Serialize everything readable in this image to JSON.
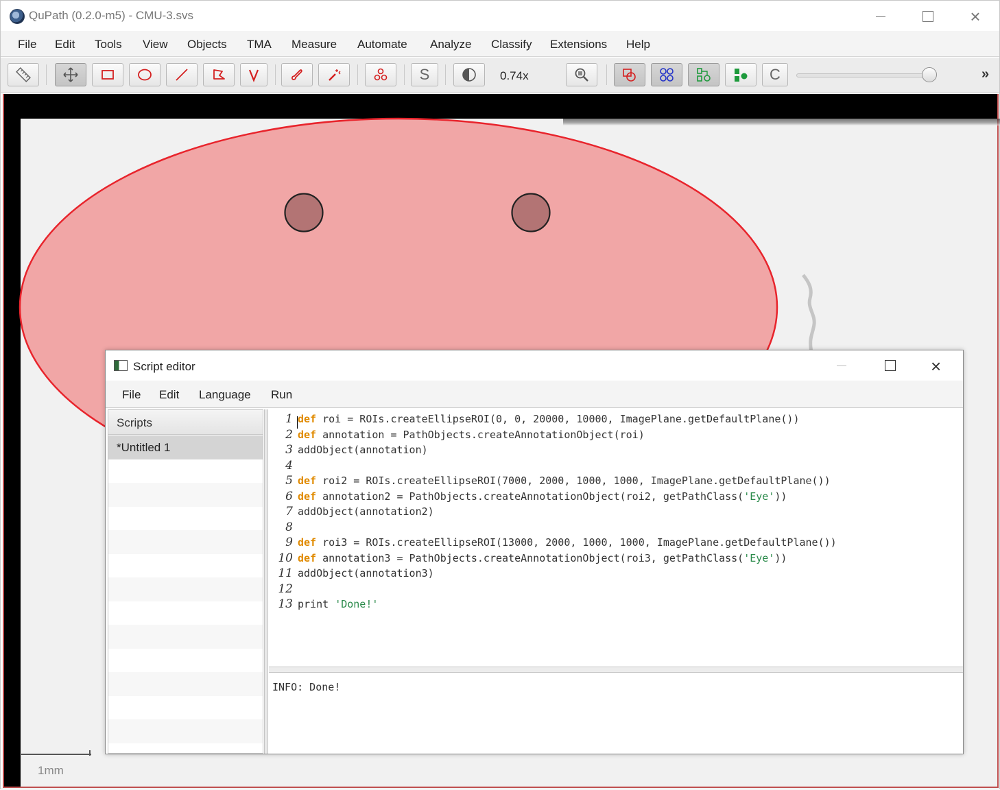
{
  "window": {
    "title": "QuPath (0.2.0-m5) - CMU-3.svs"
  },
  "menubar": {
    "items": [
      "File",
      "Edit",
      "Tools",
      "View",
      "Objects",
      "TMA",
      "Measure",
      "Automate",
      "Analyze",
      "Classify",
      "Extensions",
      "Help"
    ]
  },
  "toolbar": {
    "tools": [
      {
        "name": "measure-ruler-icon"
      },
      {
        "name": "move-icon",
        "active": true
      },
      {
        "name": "rectangle-icon"
      },
      {
        "name": "ellipse-icon"
      },
      {
        "name": "line-icon"
      },
      {
        "name": "polygon-icon"
      },
      {
        "name": "polyline-icon"
      },
      {
        "name": "brush-icon"
      },
      {
        "name": "wand-icon"
      },
      {
        "name": "points-icon"
      },
      {
        "name": "selection-mode-icon"
      },
      {
        "name": "brightness-contrast-icon"
      },
      {
        "name": "zoom-to-fit-icon"
      },
      {
        "name": "show-annotations-icon",
        "active": true
      },
      {
        "name": "show-tma-grid-icon",
        "active": true
      },
      {
        "name": "show-detections-icon",
        "active": true
      },
      {
        "name": "fill-detections-icon"
      },
      {
        "name": "show-cell-boundaries-icon"
      }
    ],
    "selection_mode_label": "S",
    "cell_label": "C",
    "zoom": "0.74x",
    "overflow": "»"
  },
  "viewer": {
    "scalebar_label": "1mm",
    "annotation_color": "#e8242c",
    "eye_color": "#9a5a5a"
  },
  "script_editor": {
    "title": "Script editor",
    "menu": [
      "File",
      "Edit",
      "Language",
      "Run"
    ],
    "scripts_header": "Scripts",
    "scripts": [
      "*Untitled 1"
    ],
    "code_lines": [
      [
        {
          "t": "def",
          "k": "kw"
        },
        {
          "t": " roi = ROIs.createEllipseROI(0, 0, 20000, 10000, ImagePlane.getDefaultPlane())"
        }
      ],
      [
        {
          "t": "def",
          "k": "kw"
        },
        {
          "t": " annotation = PathObjects.createAnnotationObject(roi)"
        }
      ],
      [
        {
          "t": "addObject(annotation)"
        }
      ],
      [
        {
          "t": ""
        }
      ],
      [
        {
          "t": "def",
          "k": "kw"
        },
        {
          "t": " roi2 = ROIs.createEllipseROI(7000, 2000, 1000, 1000, ImagePlane.getDefaultPlane())"
        }
      ],
      [
        {
          "t": "def",
          "k": "kw"
        },
        {
          "t": " annotation2 = PathObjects.createAnnotationObject(roi2, getPathClass("
        },
        {
          "t": "'Eye'",
          "k": "str"
        },
        {
          "t": "))"
        }
      ],
      [
        {
          "t": "addObject(annotation2)"
        }
      ],
      [
        {
          "t": ""
        }
      ],
      [
        {
          "t": "def",
          "k": "kw"
        },
        {
          "t": " roi3 = ROIs.createEllipseROI(13000, 2000, 1000, 1000, ImagePlane.getDefaultPlane())"
        }
      ],
      [
        {
          "t": "def",
          "k": "kw"
        },
        {
          "t": " annotation3 = PathObjects.createAnnotationObject(roi3, getPathClass("
        },
        {
          "t": "'Eye'",
          "k": "str"
        },
        {
          "t": "))"
        }
      ],
      [
        {
          "t": "addObject(annotation3)"
        }
      ],
      [
        {
          "t": ""
        }
      ],
      [
        {
          "t": "print "
        },
        {
          "t": "'Done!'",
          "k": "str"
        }
      ]
    ],
    "console_output": "INFO: Done!"
  }
}
